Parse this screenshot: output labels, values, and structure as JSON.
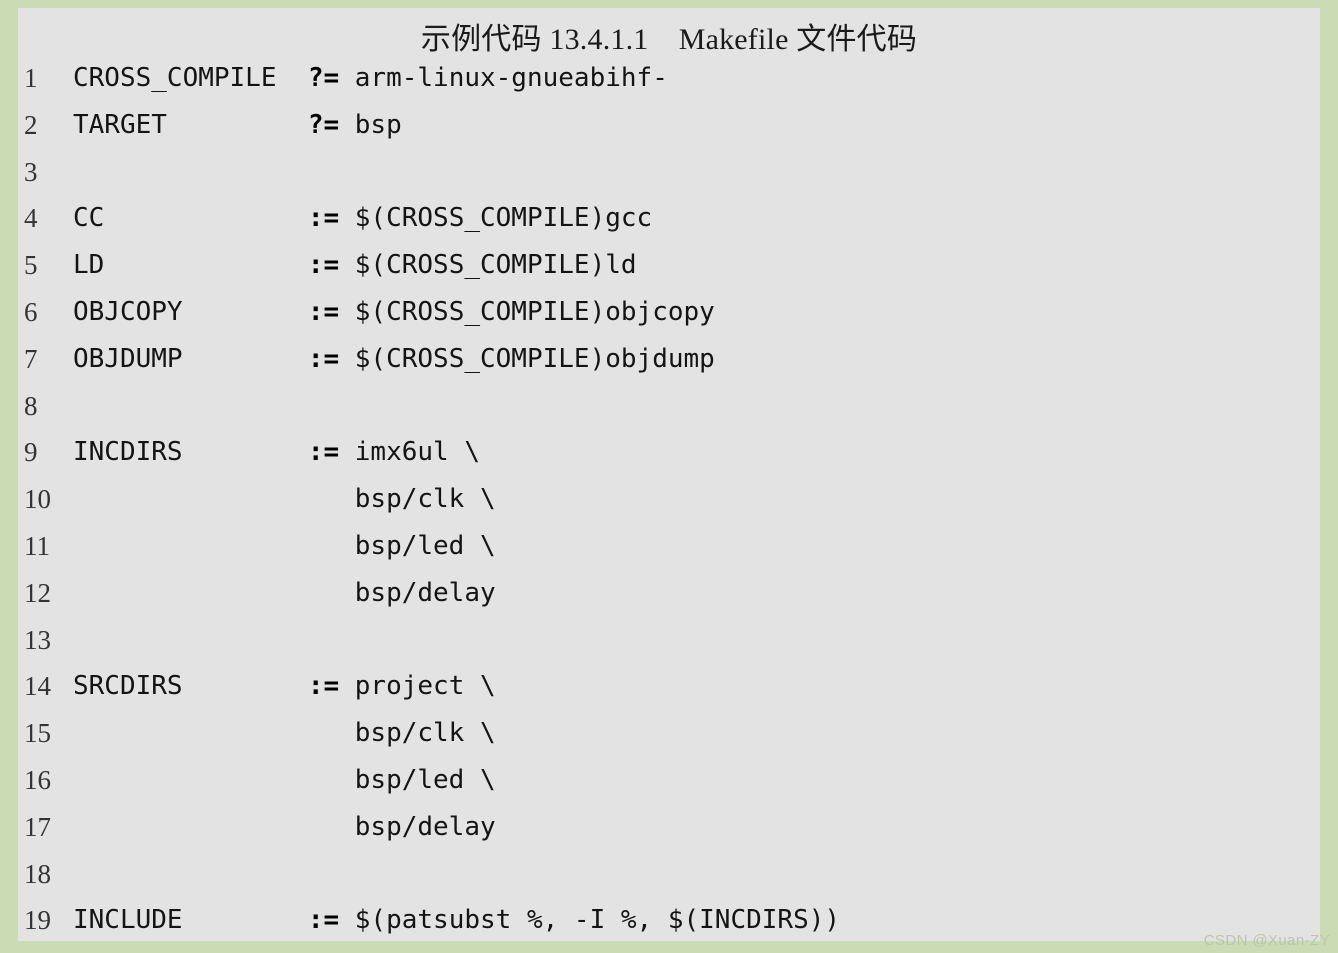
{
  "figure": {
    "caption": "示例代码 13.4.1.1　Makefile 文件代码",
    "panel_background": "#e3e3e3",
    "frame_background": "#cbdcb5",
    "text_color": "#141414"
  },
  "watermark": {
    "text": "CSDN @Xuan-ZY"
  },
  "code": {
    "language": "makefile",
    "lines": [
      {
        "number": "1",
        "before": "CROSS_COMPILE  ",
        "op": "?=",
        "after": " arm-linux-gnueabihf-"
      },
      {
        "number": "2",
        "before": "TARGET         ",
        "op": "?=",
        "after": " bsp"
      },
      {
        "number": "3",
        "before": "",
        "op": "",
        "after": ""
      },
      {
        "number": "4",
        "before": "CC             ",
        "op": ":=",
        "after": " $(CROSS_COMPILE)gcc"
      },
      {
        "number": "5",
        "before": "LD             ",
        "op": ":=",
        "after": " $(CROSS_COMPILE)ld"
      },
      {
        "number": "6",
        "before": "OBJCOPY        ",
        "op": ":=",
        "after": " $(CROSS_COMPILE)objcopy"
      },
      {
        "number": "7",
        "before": "OBJDUMP        ",
        "op": ":=",
        "after": " $(CROSS_COMPILE)objdump"
      },
      {
        "number": "8",
        "before": "",
        "op": "",
        "after": ""
      },
      {
        "number": "9",
        "before": "INCDIRS        ",
        "op": ":=",
        "after": " imx6ul \\"
      },
      {
        "number": "10",
        "before": "",
        "op": "",
        "after": "                  bsp/clk \\"
      },
      {
        "number": "11",
        "before": "",
        "op": "",
        "after": "                  bsp/led \\"
      },
      {
        "number": "12",
        "before": "",
        "op": "",
        "after": "                  bsp/delay"
      },
      {
        "number": "13",
        "before": "",
        "op": "",
        "after": ""
      },
      {
        "number": "14",
        "before": "SRCDIRS        ",
        "op": ":=",
        "after": " project \\"
      },
      {
        "number": "15",
        "before": "",
        "op": "",
        "after": "                  bsp/clk \\"
      },
      {
        "number": "16",
        "before": "",
        "op": "",
        "after": "                  bsp/led \\"
      },
      {
        "number": "17",
        "before": "",
        "op": "",
        "after": "                  bsp/delay"
      },
      {
        "number": "18",
        "before": "",
        "op": "",
        "after": ""
      },
      {
        "number": "19",
        "before": "INCLUDE        ",
        "op": ":=",
        "after": " $(patsubst %, -I %, $(INCDIRS))"
      }
    ]
  }
}
